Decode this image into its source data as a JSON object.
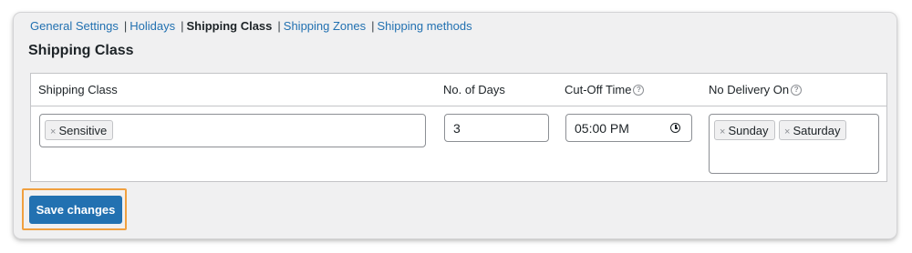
{
  "nav": {
    "items": [
      {
        "label": "General Settings",
        "current": false
      },
      {
        "label": "Holidays",
        "current": false
      },
      {
        "label": "Shipping Class",
        "current": true
      },
      {
        "label": "Shipping Zones",
        "current": false
      },
      {
        "label": "Shipping methods",
        "current": false
      }
    ],
    "separator": "|"
  },
  "page_title": "Shipping Class",
  "table": {
    "headers": {
      "shipping_class": "Shipping Class",
      "no_of_days": "No. of Days",
      "cutoff_time": "Cut-Off Time",
      "no_delivery_on": "No Delivery On"
    },
    "help_icon": "?",
    "row": {
      "shipping_class_tags": [
        "Sensitive"
      ],
      "no_of_days": "3",
      "cutoff_time": "05:00 PM",
      "no_delivery_on_tags": [
        "Sunday",
        "Saturday"
      ],
      "tag_remove": "×"
    }
  },
  "save_button": "Save changes",
  "colors": {
    "link": "#2271b1",
    "button_bg": "#2271b1",
    "highlight_outline": "#f0a040",
    "panel_bg": "#f0f0f1"
  }
}
